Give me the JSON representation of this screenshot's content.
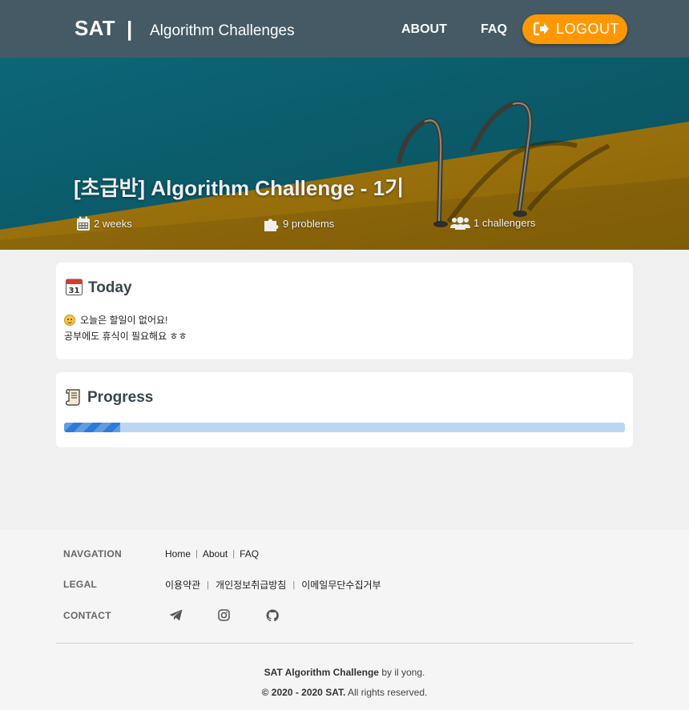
{
  "header": {
    "brand": "SAT",
    "separator": "|",
    "subtitle": "Algorithm Challenges",
    "nav": {
      "about": "ABOUT",
      "faq": "FAQ"
    },
    "logout_label": "LOGOUT",
    "logout_color": "#ff9800",
    "bar_color": "#455a64"
  },
  "hero": {
    "title": "[초급반] Algorithm Challenge - 1기",
    "stats": {
      "weeks": "2 weeks",
      "problems": "9 problems",
      "challengers": "1 challengers"
    }
  },
  "today": {
    "title": "Today",
    "icon": "calendar-emoji-icon",
    "line1": "오늘은 할일이 없어요!",
    "line2": "공부에도 휴식이 필요해요 ㅎㅎ"
  },
  "progress": {
    "title": "Progress",
    "icon": "scroll-emoji-icon",
    "fraction": 0.1,
    "fill_color": "#2e7bd6",
    "track_color": "#bbd6f1"
  },
  "footer": {
    "navigation_label": "NAVGATION",
    "nav_links": [
      "Home",
      "About",
      "FAQ"
    ],
    "legal_label": "LEGAL",
    "legal_links": [
      "이용약관",
      "개인정보취급방침",
      "이메일무단수집거부"
    ],
    "contact_label": "CONTACT",
    "contact_icons": [
      "telegram-icon",
      "instagram-icon",
      "github-icon"
    ],
    "credit_bold": "SAT Algorithm Challenge",
    "credit_rest": " by il yong.",
    "copyright_bold": "© 2020 - 2020 SAT.",
    "copyright_rest": " All rights reserved."
  }
}
